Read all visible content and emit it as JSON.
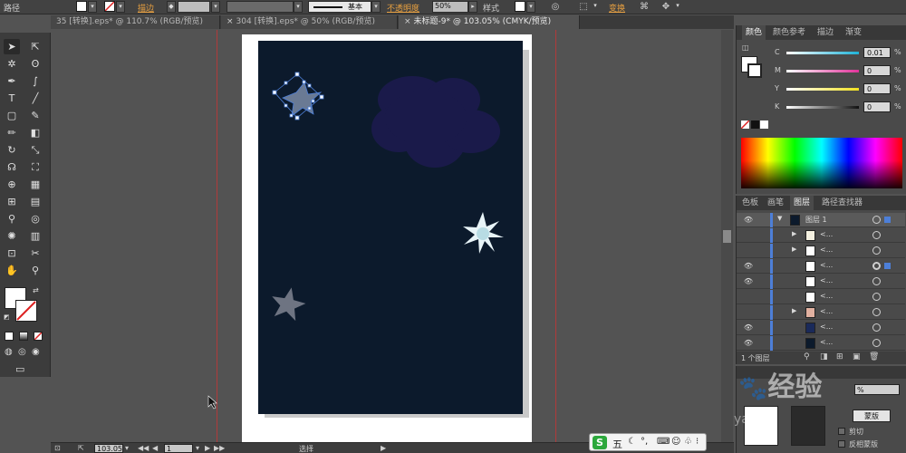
{
  "control_bar": {
    "selection_label": "路径",
    "stroke_label": "描边",
    "profile_label": "基本",
    "opacity_label": "不透明度",
    "opacity_value": "50%",
    "style_label": "样式",
    "transform_label": "变换"
  },
  "tabs": [
    {
      "label": "35 [转换].eps* @ 110.7% (RGB/预览)"
    },
    {
      "label": "304 [转换].eps* @ 50% (RGB/预览)"
    },
    {
      "label": "未标题-9* @ 103.05% (CMYK/预览)"
    }
  ],
  "active_tab_index": 2,
  "color_panel": {
    "tabs": [
      "颜色",
      "颜色参考",
      "描边",
      "渐变"
    ],
    "active_tab": 0,
    "sliders": [
      {
        "label": "C",
        "value": "0.01",
        "pct": "%",
        "color": "#1fb3d8"
      },
      {
        "label": "M",
        "value": "0",
        "pct": "%",
        "color": "#e0339a"
      },
      {
        "label": "Y",
        "value": "0",
        "pct": "%",
        "color": "#f0e020"
      },
      {
        "label": "K",
        "value": "0",
        "pct": "%",
        "color": "#1a1a1a"
      }
    ]
  },
  "layers_panel": {
    "tabs": [
      "色板",
      "画笔",
      "图层",
      "路径查找器"
    ],
    "active_tab": 2,
    "layer_name": "图层 1",
    "sublayers": [
      "<...",
      "<...",
      "<...",
      "<...",
      "<...",
      "<...",
      "<...",
      "<..."
    ],
    "footer_count": "1 个图层"
  },
  "transparency_panel": {
    "pct": "%",
    "mask_button": "蒙版",
    "clip_label": "剪切",
    "invert_label": "反相蒙版"
  },
  "status_bar": {
    "zoom": "103.05",
    "artboard": "1",
    "mode": "选择"
  },
  "ime": {
    "logo": "S",
    "mode": "五"
  },
  "watermark": {
    "text": "经验",
    "url": "yan."
  },
  "colors": {
    "artboard_bg": "#0c1a2c",
    "guide": "#b13a3a",
    "cloud": "#1a1a4a",
    "accent_orange": "#e8a040"
  }
}
